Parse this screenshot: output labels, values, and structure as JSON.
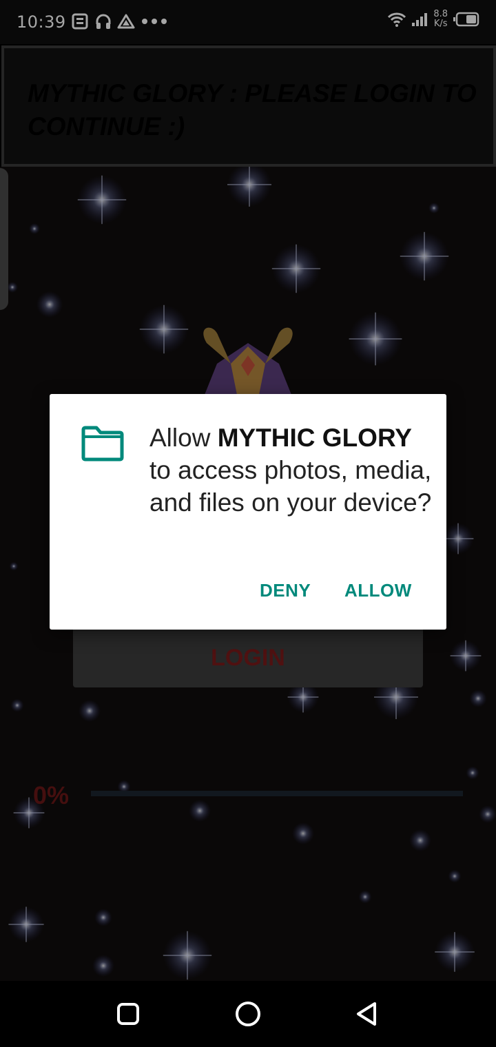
{
  "status_bar": {
    "time": "10:39",
    "net_speed_value": "8.8",
    "net_speed_unit": "K/s",
    "icons_left": [
      "news-icon",
      "headphones-icon",
      "drive-icon",
      "more-dots-icon"
    ],
    "icons_right": [
      "wifi-icon",
      "signal-icon",
      "battery-icon"
    ]
  },
  "banner": {
    "text": "MYTHIC GLORY : PLEASE LOGIN TO CONTINUE :)"
  },
  "game": {
    "login_label": "LOGIN",
    "progress_label": "0%",
    "progress_value": 0
  },
  "dialog": {
    "icon": "folder-icon",
    "message_prefix": "Allow ",
    "app_name": "MYTHIC GLORY",
    "message_suffix": " to access photos, media, and files on your device?",
    "deny_label": "DENY",
    "allow_label": "ALLOW",
    "accent_color": "#00897b"
  },
  "nav_bar": {
    "buttons": [
      "recents-icon",
      "home-icon",
      "back-icon"
    ]
  }
}
